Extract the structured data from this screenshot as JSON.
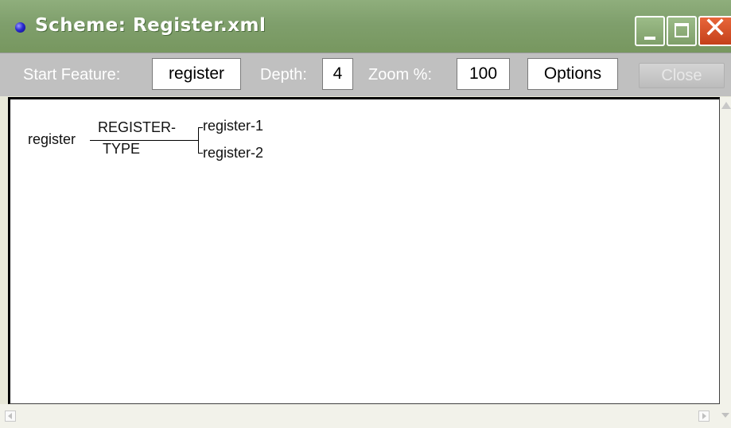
{
  "window": {
    "title": "Scheme: Register.xml",
    "title_bar_color": "#7f9f6c",
    "controls": {
      "minimize": "minimize-icon",
      "maximize": "maximize-icon",
      "close": "close-icon"
    }
  },
  "toolbar": {
    "start_feature_label": "Start Feature:",
    "start_feature_value": "register",
    "depth_label": "Depth:",
    "depth_value": "4",
    "zoom_label": "Zoom %:",
    "zoom_value": "100",
    "options_label": "Options",
    "close_label": "Close"
  },
  "scheme": {
    "root": "register",
    "type_line1": "REGISTER-",
    "type_line2": "TYPE",
    "children": [
      "register-1",
      "register-2"
    ]
  }
}
